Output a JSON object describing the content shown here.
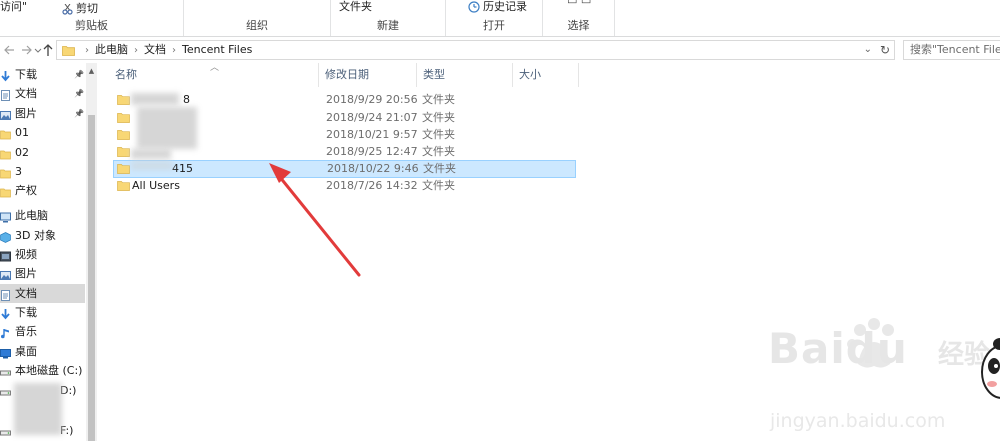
{
  "ribbon": {
    "clipboard": {
      "partial_label": "访问\"",
      "cut_label": "剪切",
      "group_label": "剪贴板"
    },
    "organize": {
      "group_label": "组织"
    },
    "new": {
      "folder_label": "文件夹",
      "group_label": "新建"
    },
    "open": {
      "history_label": "历史记录",
      "group_label": "打开"
    },
    "select": {
      "group_label": "选择"
    }
  },
  "nav": {
    "breadcrumb": [
      "此电脑",
      "文档",
      "Tencent Files"
    ],
    "search_placeholder": "搜索\"Tencent Files\""
  },
  "sidebar": {
    "items": [
      {
        "label": "下载",
        "icon": "download-icon",
        "pinned": true
      },
      {
        "label": "文档",
        "icon": "document-icon",
        "pinned": true
      },
      {
        "label": "图片",
        "icon": "pictures-icon",
        "pinned": true
      },
      {
        "label": "01",
        "icon": "folder-icon"
      },
      {
        "label": "02",
        "icon": "folder-icon"
      },
      {
        "label": "3",
        "icon": "folder-icon"
      },
      {
        "label": "产权",
        "icon": "folder-icon"
      },
      {
        "label": "此电脑",
        "icon": "computer-icon"
      },
      {
        "label": "3D 对象",
        "icon": "3d-objects-icon"
      },
      {
        "label": "视频",
        "icon": "video-icon"
      },
      {
        "label": "图片",
        "icon": "pictures-icon"
      },
      {
        "label": "文档",
        "icon": "document-icon",
        "selected": true
      },
      {
        "label": "下载",
        "icon": "download-icon"
      },
      {
        "label": "音乐",
        "icon": "music-icon"
      },
      {
        "label": "桌面",
        "icon": "desktop-icon"
      },
      {
        "label": "本地磁盘 (C:)",
        "icon": "drive-icon"
      }
    ],
    "partial_drive_d": "D:)",
    "partial_drive_f": "F:)"
  },
  "columns": {
    "name": "名称",
    "date": "修改日期",
    "type": "类型",
    "size": "大小"
  },
  "files": [
    {
      "name": "8",
      "date": "2018/9/29 20:56",
      "type": "文件夹"
    },
    {
      "name": "",
      "date": "2018/9/24 21:07",
      "type": "文件夹"
    },
    {
      "name": "",
      "date": "2018/10/21 9:57",
      "type": "文件夹"
    },
    {
      "name": "",
      "date": "2018/9/25 12:47",
      "type": "文件夹"
    },
    {
      "name": "415",
      "date": "2018/10/22 9:46",
      "type": "文件夹",
      "selected": true
    },
    {
      "name": "All Users",
      "date": "2018/7/26 14:32",
      "type": "文件夹"
    }
  ],
  "watermark": {
    "brand": "Baidu",
    "suffix": "经验",
    "url": "jingyan.baidu.com"
  },
  "colors": {
    "selection_fill": "#cce8ff",
    "selection_border": "#99d1ff",
    "folder": "#f8d775",
    "arrow": "#e23b3b"
  }
}
